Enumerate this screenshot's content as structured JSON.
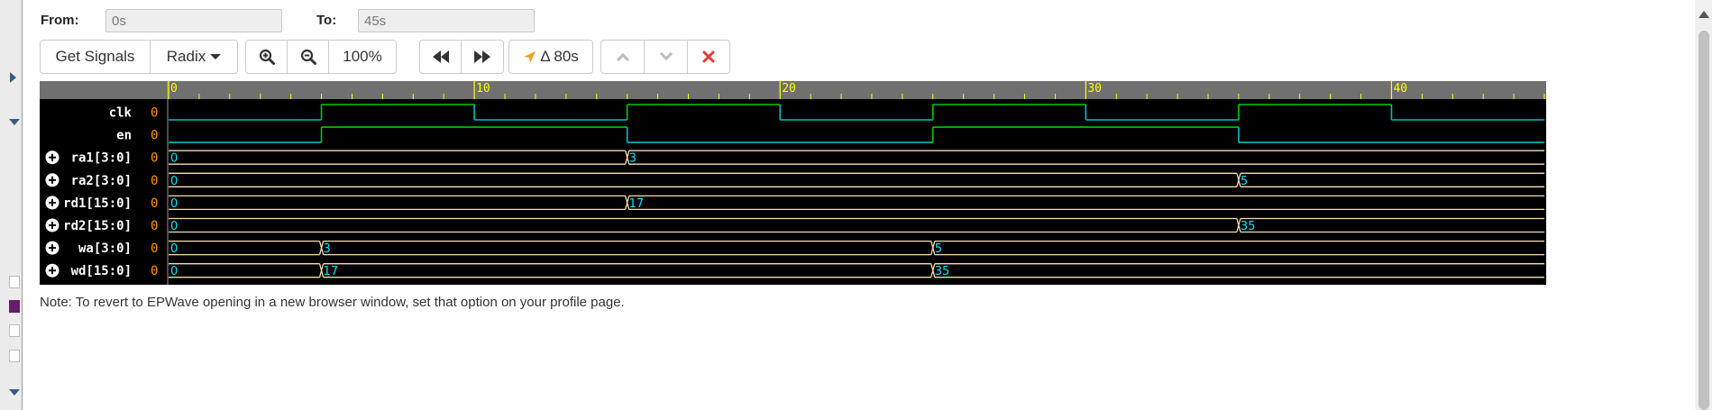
{
  "range": {
    "from_label": "From:",
    "from_value": "0s",
    "to_label": "To:",
    "to_value": "45s"
  },
  "toolbar": {
    "get_signals": "Get Signals",
    "radix": "Radix",
    "zoom_level": "100%",
    "delta": "Δ 80s"
  },
  "icons": {
    "zoom_in": "zoom-in-icon",
    "zoom_out": "zoom-out-icon",
    "prev_edge": "fast-backward-icon",
    "next_edge": "fast-forward-icon",
    "cursor": "location-arrow-icon",
    "up": "chevron-up-icon",
    "down": "chevron-down-icon",
    "remove": "close-icon",
    "expand": "plus-circle-icon"
  },
  "colors": {
    "wave_bg": "#000000",
    "ruler_bg": "#707070",
    "ruler_text": "#ffff00",
    "signal_name": "#ffffff",
    "signal_value": "#ff9900",
    "high": "#00cc00",
    "low": "#00bfbf",
    "bus_label": "#00e5ff",
    "bus_border": "#f5deb3",
    "remove": "#e53935",
    "cursor": "#f0a020"
  },
  "ruler": {
    "t_max": 45,
    "major_labels": [
      "0",
      "10",
      "20",
      "30",
      "40"
    ],
    "major_times": [
      0,
      10,
      20,
      30,
      40
    ]
  },
  "signals": [
    {
      "name": "clk",
      "value": "0",
      "kind": "bit",
      "expandable": false,
      "levels": [
        [
          0,
          0
        ],
        [
          5,
          1
        ],
        [
          10,
          0
        ],
        [
          15,
          1
        ],
        [
          20,
          0
        ],
        [
          25,
          1
        ],
        [
          30,
          0
        ],
        [
          35,
          1
        ],
        [
          40,
          0
        ]
      ]
    },
    {
      "name": "en",
      "value": "0",
      "kind": "bit",
      "expandable": false,
      "levels": [
        [
          0,
          0
        ],
        [
          5,
          1
        ],
        [
          15,
          0
        ],
        [
          25,
          1
        ],
        [
          35,
          0
        ]
      ]
    },
    {
      "name": "ra1[3:0]",
      "value": "0",
      "kind": "bus",
      "expandable": true,
      "segments": [
        [
          0,
          "0"
        ],
        [
          15,
          "3"
        ]
      ]
    },
    {
      "name": "ra2[3:0]",
      "value": "0",
      "kind": "bus",
      "expandable": true,
      "segments": [
        [
          0,
          "0"
        ],
        [
          35,
          "5"
        ]
      ]
    },
    {
      "name": "rd1[15:0]",
      "value": "0",
      "kind": "bus",
      "expandable": true,
      "segments": [
        [
          0,
          "0"
        ],
        [
          15,
          "17"
        ]
      ]
    },
    {
      "name": "rd2[15:0]",
      "value": "0",
      "kind": "bus",
      "expandable": true,
      "segments": [
        [
          0,
          "0"
        ],
        [
          35,
          "35"
        ]
      ]
    },
    {
      "name": "wa[3:0]",
      "value": "0",
      "kind": "bus",
      "expandable": true,
      "segments": [
        [
          0,
          "0"
        ],
        [
          5,
          "3"
        ],
        [
          25,
          "5"
        ]
      ]
    },
    {
      "name": "wd[15:0]",
      "value": "0",
      "kind": "bus",
      "expandable": true,
      "segments": [
        [
          0,
          "0"
        ],
        [
          5,
          "17"
        ],
        [
          25,
          "35"
        ]
      ]
    }
  ],
  "note": "Note: To revert to EPWave opening in a new browser window, set that option on your profile page."
}
